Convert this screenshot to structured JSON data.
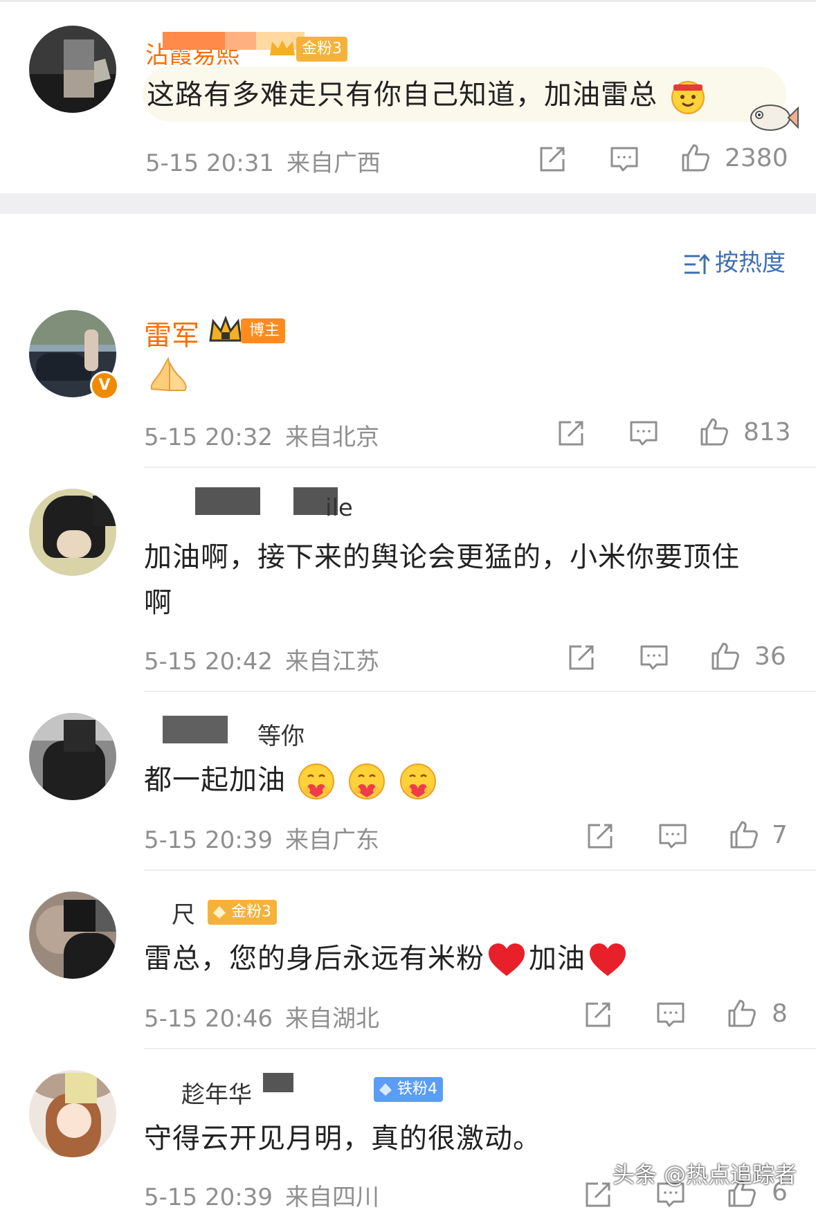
{
  "sort_label": "按热度",
  "watermark": "头条 @热点追踪者",
  "comments": [
    {
      "username_visible": "沾霞易熙",
      "badge": "金粉3",
      "text": "这路有多难走只有你自己知道，加油雷总",
      "date": "5-15 20:31",
      "location": "来自广西",
      "likes": "2380"
    },
    {
      "username_visible": "雷军",
      "badge": "博主",
      "text": "",
      "date": "5-15 20:32",
      "location": "来自北京",
      "likes": "813"
    },
    {
      "username_visible": "ile",
      "text": "加油啊，接下来的舆论会更猛的，小米你要顶住啊",
      "date": "5-15 20:42",
      "location": "来自江苏",
      "likes": "36"
    },
    {
      "username_visible": "等你",
      "text": "都一起加油",
      "date": "5-15 20:39",
      "location": "来自广东",
      "likes": "7"
    },
    {
      "username_visible": "尺",
      "badge": "金粉3",
      "text_a": "雷总，您的身后永远有米粉",
      "text_b": "加油",
      "date": "5-15 20:46",
      "location": "来自湖北",
      "likes": "8"
    },
    {
      "username_visible": "趁年华",
      "badge": "铁粉4",
      "text": "守得云开见月明，真的很激动。",
      "date": "5-15 20:39",
      "location": "来自四川",
      "likes": "6"
    }
  ],
  "icons": [
    "repost-icon",
    "comment-icon",
    "like-icon",
    "sort-icon",
    "verified-v-icon",
    "crown-icon"
  ],
  "colors": {
    "accent_blue": "#3e6fb3",
    "gold_badge": "#f5b23a",
    "iron_badge": "#5b9df5",
    "username_orange": "#ff6d00"
  }
}
